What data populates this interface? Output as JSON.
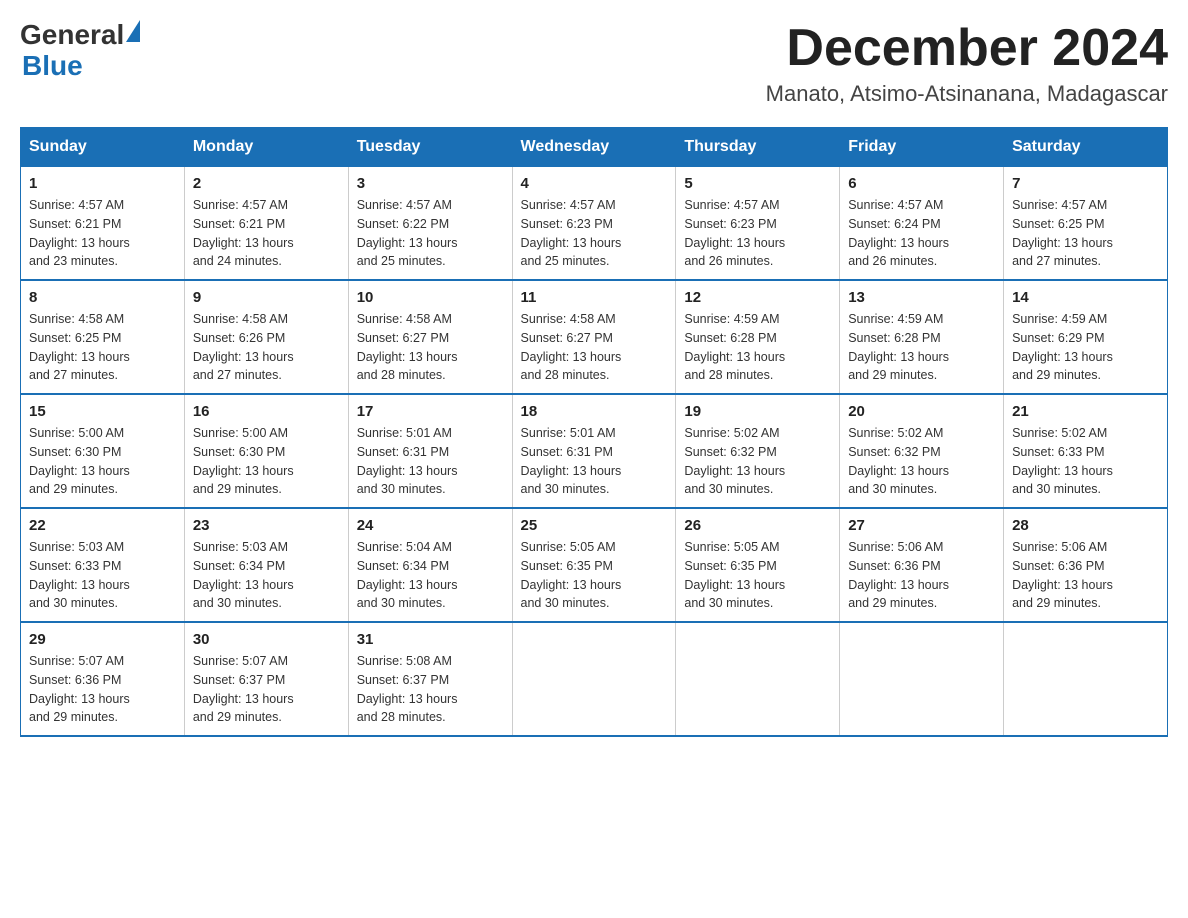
{
  "header": {
    "logo_general": "General",
    "logo_blue": "Blue",
    "month_title": "December 2024",
    "location": "Manato, Atsimo-Atsinanana, Madagascar"
  },
  "days_of_week": [
    "Sunday",
    "Monday",
    "Tuesday",
    "Wednesday",
    "Thursday",
    "Friday",
    "Saturday"
  ],
  "weeks": [
    [
      {
        "day": "1",
        "sunrise": "4:57 AM",
        "sunset": "6:21 PM",
        "daylight": "13 hours and 23 minutes."
      },
      {
        "day": "2",
        "sunrise": "4:57 AM",
        "sunset": "6:21 PM",
        "daylight": "13 hours and 24 minutes."
      },
      {
        "day": "3",
        "sunrise": "4:57 AM",
        "sunset": "6:22 PM",
        "daylight": "13 hours and 25 minutes."
      },
      {
        "day": "4",
        "sunrise": "4:57 AM",
        "sunset": "6:23 PM",
        "daylight": "13 hours and 25 minutes."
      },
      {
        "day": "5",
        "sunrise": "4:57 AM",
        "sunset": "6:23 PM",
        "daylight": "13 hours and 26 minutes."
      },
      {
        "day": "6",
        "sunrise": "4:57 AM",
        "sunset": "6:24 PM",
        "daylight": "13 hours and 26 minutes."
      },
      {
        "day": "7",
        "sunrise": "4:57 AM",
        "sunset": "6:25 PM",
        "daylight": "13 hours and 27 minutes."
      }
    ],
    [
      {
        "day": "8",
        "sunrise": "4:58 AM",
        "sunset": "6:25 PM",
        "daylight": "13 hours and 27 minutes."
      },
      {
        "day": "9",
        "sunrise": "4:58 AM",
        "sunset": "6:26 PM",
        "daylight": "13 hours and 27 minutes."
      },
      {
        "day": "10",
        "sunrise": "4:58 AM",
        "sunset": "6:27 PM",
        "daylight": "13 hours and 28 minutes."
      },
      {
        "day": "11",
        "sunrise": "4:58 AM",
        "sunset": "6:27 PM",
        "daylight": "13 hours and 28 minutes."
      },
      {
        "day": "12",
        "sunrise": "4:59 AM",
        "sunset": "6:28 PM",
        "daylight": "13 hours and 28 minutes."
      },
      {
        "day": "13",
        "sunrise": "4:59 AM",
        "sunset": "6:28 PM",
        "daylight": "13 hours and 29 minutes."
      },
      {
        "day": "14",
        "sunrise": "4:59 AM",
        "sunset": "6:29 PM",
        "daylight": "13 hours and 29 minutes."
      }
    ],
    [
      {
        "day": "15",
        "sunrise": "5:00 AM",
        "sunset": "6:30 PM",
        "daylight": "13 hours and 29 minutes."
      },
      {
        "day": "16",
        "sunrise": "5:00 AM",
        "sunset": "6:30 PM",
        "daylight": "13 hours and 29 minutes."
      },
      {
        "day": "17",
        "sunrise": "5:01 AM",
        "sunset": "6:31 PM",
        "daylight": "13 hours and 30 minutes."
      },
      {
        "day": "18",
        "sunrise": "5:01 AM",
        "sunset": "6:31 PM",
        "daylight": "13 hours and 30 minutes."
      },
      {
        "day": "19",
        "sunrise": "5:02 AM",
        "sunset": "6:32 PM",
        "daylight": "13 hours and 30 minutes."
      },
      {
        "day": "20",
        "sunrise": "5:02 AM",
        "sunset": "6:32 PM",
        "daylight": "13 hours and 30 minutes."
      },
      {
        "day": "21",
        "sunrise": "5:02 AM",
        "sunset": "6:33 PM",
        "daylight": "13 hours and 30 minutes."
      }
    ],
    [
      {
        "day": "22",
        "sunrise": "5:03 AM",
        "sunset": "6:33 PM",
        "daylight": "13 hours and 30 minutes."
      },
      {
        "day": "23",
        "sunrise": "5:03 AM",
        "sunset": "6:34 PM",
        "daylight": "13 hours and 30 minutes."
      },
      {
        "day": "24",
        "sunrise": "5:04 AM",
        "sunset": "6:34 PM",
        "daylight": "13 hours and 30 minutes."
      },
      {
        "day": "25",
        "sunrise": "5:05 AM",
        "sunset": "6:35 PM",
        "daylight": "13 hours and 30 minutes."
      },
      {
        "day": "26",
        "sunrise": "5:05 AM",
        "sunset": "6:35 PM",
        "daylight": "13 hours and 30 minutes."
      },
      {
        "day": "27",
        "sunrise": "5:06 AM",
        "sunset": "6:36 PM",
        "daylight": "13 hours and 29 minutes."
      },
      {
        "day": "28",
        "sunrise": "5:06 AM",
        "sunset": "6:36 PM",
        "daylight": "13 hours and 29 minutes."
      }
    ],
    [
      {
        "day": "29",
        "sunrise": "5:07 AM",
        "sunset": "6:36 PM",
        "daylight": "13 hours and 29 minutes."
      },
      {
        "day": "30",
        "sunrise": "5:07 AM",
        "sunset": "6:37 PM",
        "daylight": "13 hours and 29 minutes."
      },
      {
        "day": "31",
        "sunrise": "5:08 AM",
        "sunset": "6:37 PM",
        "daylight": "13 hours and 28 minutes."
      },
      null,
      null,
      null,
      null
    ]
  ],
  "labels": {
    "sunrise": "Sunrise:",
    "sunset": "Sunset:",
    "daylight": "Daylight:"
  }
}
